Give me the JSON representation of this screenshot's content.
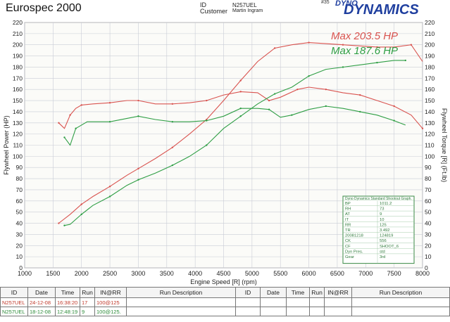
{
  "header": {
    "title": "Eurospec 2000",
    "id_label": "ID",
    "id_value": "N257UEL",
    "customer_label": "Customer",
    "customer_value": "Martin Ingram",
    "run_number": "#35",
    "logo_line1": "DYNO",
    "logo_line2": "DYNAMICS"
  },
  "chart_data": {
    "type": "line",
    "xlabel": "Engine Speed [R] (rpm)",
    "ylabel_left": "Flywheel Power (HP)",
    "ylabel_right": "Flywheel Torque [R] (Ft.lb)",
    "xlim": [
      1000,
      8000
    ],
    "ylim": [
      0,
      220
    ],
    "xticks": [
      1000,
      1500,
      2000,
      2500,
      3000,
      3500,
      4000,
      4500,
      5000,
      5500,
      6000,
      6500,
      7000,
      7500,
      8000
    ],
    "yticks": [
      0,
      10,
      20,
      30,
      40,
      50,
      60,
      70,
      80,
      90,
      100,
      110,
      120,
      130,
      140,
      150,
      160,
      170,
      180,
      190,
      200,
      210,
      220
    ],
    "grid": true,
    "annotations": [
      {
        "text": "Max 203.5 HP",
        "color": "#d9534f"
      },
      {
        "text": "Max 187.6 HP",
        "color": "#2e9e44"
      }
    ],
    "colors": {
      "red": "#d9534f",
      "green": "#2e9e44"
    },
    "series": [
      {
        "id": "power_red",
        "color": "#d9534f",
        "x": [
          1600,
          1800,
          2000,
          2200,
          2500,
          2800,
          3000,
          3300,
          3600,
          3900,
          4200,
          4500,
          4800,
          5100,
          5400,
          5700,
          6000,
          6300,
          6600,
          6900,
          7200,
          7500,
          7800,
          8000
        ],
        "y": [
          40,
          48,
          57,
          64,
          73,
          83,
          89,
          98,
          108,
          120,
          133,
          150,
          168,
          185,
          197,
          200,
          202,
          201,
          200,
          199,
          198,
          198,
          200,
          185
        ]
      },
      {
        "id": "torque_red",
        "color": "#d9534f",
        "x": [
          1600,
          1700,
          1800,
          1900,
          2000,
          2200,
          2500,
          2800,
          3000,
          3300,
          3600,
          3900,
          4200,
          4500,
          4800,
          5100,
          5300,
          5500,
          5800,
          6000,
          6300,
          6600,
          6900,
          7200,
          7500,
          7800,
          8000
        ],
        "y": [
          130,
          125,
          137,
          143,
          146,
          147,
          148,
          150,
          150,
          147,
          147,
          148,
          150,
          155,
          158,
          157,
          150,
          153,
          160,
          162,
          160,
          157,
          155,
          150,
          145,
          137,
          125
        ]
      },
      {
        "id": "power_green",
        "color": "#2e9e44",
        "x": [
          1700,
          1800,
          2000,
          2200,
          2500,
          2800,
          3000,
          3300,
          3600,
          3900,
          4200,
          4500,
          4800,
          5100,
          5400,
          5700,
          6000,
          6300,
          6600,
          6900,
          7200,
          7500,
          7700
        ],
        "y": [
          38,
          39,
          48,
          56,
          64,
          74,
          79,
          85,
          92,
          100,
          110,
          125,
          136,
          147,
          156,
          162,
          172,
          178,
          180,
          182,
          184,
          186,
          186
        ]
      },
      {
        "id": "torque_green",
        "color": "#2e9e44",
        "x": [
          1700,
          1800,
          1900,
          2100,
          2500,
          2800,
          3000,
          3300,
          3600,
          3900,
          4200,
          4500,
          4800,
          5100,
          5300,
          5500,
          5700,
          6000,
          6300,
          6600,
          6900,
          7200,
          7500,
          7700
        ],
        "y": [
          117,
          110,
          125,
          131,
          131,
          134,
          136,
          133,
          131,
          131,
          132,
          136,
          143,
          143,
          142,
          135,
          137,
          142,
          145,
          143,
          140,
          137,
          132,
          128
        ]
      }
    ],
    "shootout": {
      "title": "Dyno Dynamics Standard Shootout Graph.",
      "rows": [
        {
          "key": "BP",
          "value": "1011.2"
        },
        {
          "key": "RH",
          "value": "73"
        },
        {
          "key": "AT",
          "value": "9"
        },
        {
          "key": "IT",
          "value": "10"
        },
        {
          "key": "RR",
          "value": "125"
        },
        {
          "key": "TR",
          "value": "3.492"
        },
        {
          "key": "20081218",
          "value": "124819"
        },
        {
          "key": "CK",
          "value": "556"
        },
        {
          "key": "CF",
          "value": "SHOOT_6"
        },
        {
          "key": "Dyn Pres.",
          "value": "std"
        },
        {
          "key": "Gear",
          "value": "3rd"
        }
      ]
    }
  },
  "run_table": {
    "headers": [
      "ID",
      "Date",
      "Time",
      "Run",
      "IN@RR",
      "Run Description",
      "ID",
      "Date",
      "Time",
      "Run",
      "IN@RR",
      "Run Description"
    ],
    "rows": [
      {
        "id": "N257UEL",
        "date": "24-12-08",
        "time": "16:38:20",
        "run": "17",
        "inrr": "100@125",
        "desc": ""
      },
      {
        "id": "N257UEL",
        "date": "18-12-08",
        "time": "12:48:19",
        "run": "9",
        "inrr": "100@125.",
        "desc": ""
      }
    ]
  }
}
